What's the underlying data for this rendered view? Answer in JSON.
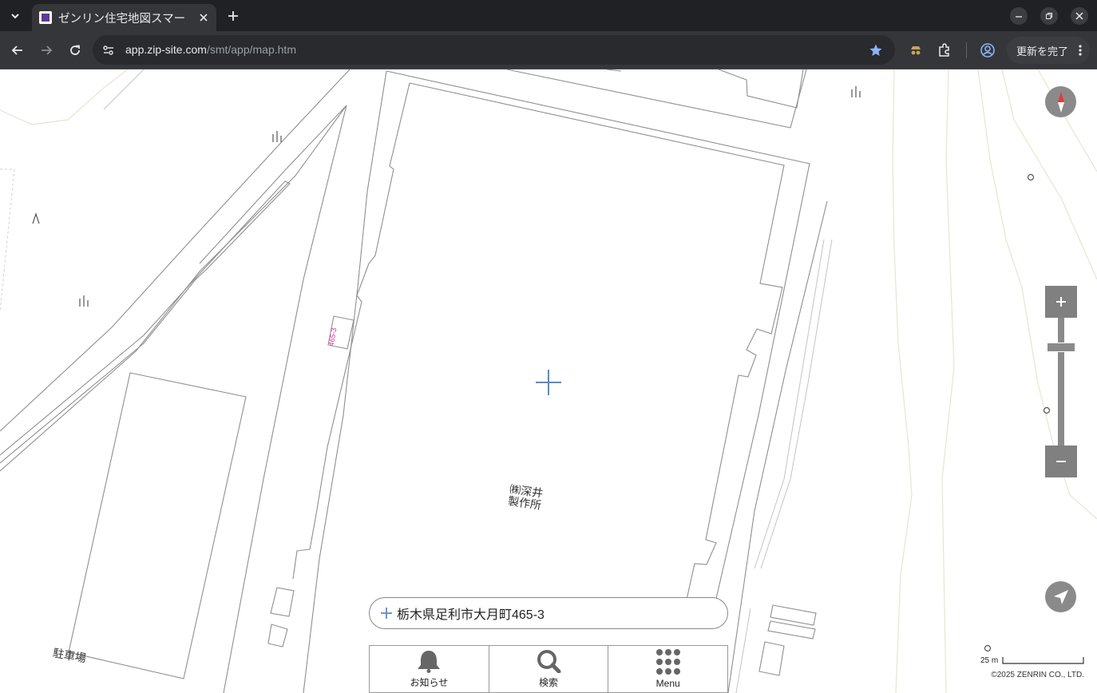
{
  "browser": {
    "tab_title": "ゼンリン住宅地図スマー",
    "url_host": "app.zip-site.com",
    "url_path": "/smt/app/map.htm",
    "update_button": "更新を完了"
  },
  "map": {
    "building_label": "㈱深井\n製作所",
    "parking_label": "駐車場",
    "lot_number": "465-3",
    "search_address": "栃木県足利市大月町465-3",
    "scale_label": "25 m",
    "copyright": "©2025 ZENRIN CO., LTD."
  },
  "bottom_nav": [
    {
      "label": "お知らせ",
      "icon": "bell-icon"
    },
    {
      "label": "検索",
      "icon": "search-icon"
    },
    {
      "label": "Menu",
      "icon": "grid-menu-icon"
    }
  ],
  "colors": {
    "control_gray": "#808080",
    "crosshair": "#5a8ac6",
    "accent_star": "#8ab4f8"
  }
}
